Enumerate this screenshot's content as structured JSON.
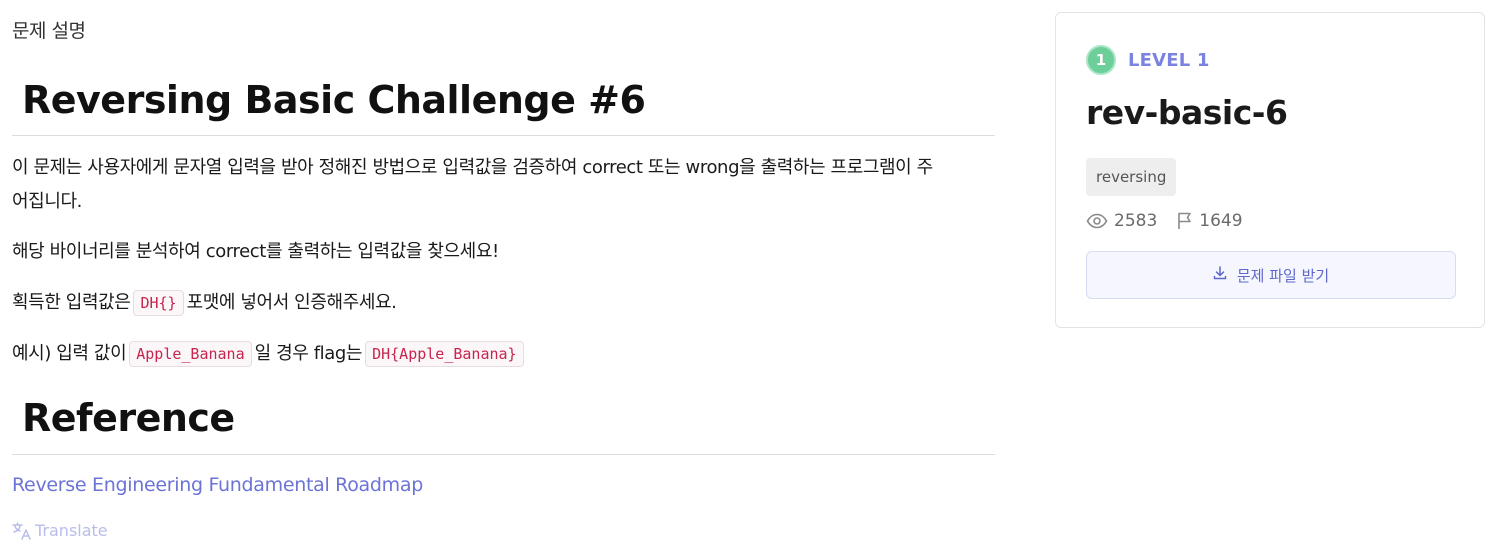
{
  "section_title": "문제 설명",
  "content": {
    "heading": "Reversing Basic Challenge #6",
    "paragraph1_line1": "이 문제는 사용자에게 문자열 입력을 받아 정해진 방법으로 입력값을 검증하여 correct 또는 wrong을 출력하는 프로그램이 주",
    "paragraph1_line2": "어집니다.",
    "paragraph2": "해당 바이너리를 분석하여 correct를 출력하는 입력값을 찾으세요!",
    "paragraph3_before": "획득한 입력값은",
    "paragraph3_code": "DH{}",
    "paragraph3_after": "포맷에 넣어서 인증해주세요.",
    "paragraph4_before": "예시) 입력 값이",
    "paragraph4_code1": "Apple_Banana",
    "paragraph4_middle": "일 경우 flag는",
    "paragraph4_code2": "DH{Apple_Banana}",
    "reference_heading": "Reference",
    "reference_link": "Reverse Engineering Fundamental Roadmap",
    "translate_label": "Translate"
  },
  "card": {
    "level_number": "1",
    "level_label": "LEVEL 1",
    "title": "rev-basic-6",
    "tag": "reversing",
    "views": "2583",
    "solves": "1649",
    "download_label": "문제 파일 받기"
  },
  "colors": {
    "accent": "#7b83e0",
    "level_green": "#6ccf9a",
    "code_red": "#c7254e",
    "link": "#6b73d6"
  },
  "icons": {
    "views": "eye-icon",
    "solves": "flag-icon",
    "download": "download-icon",
    "translate": "translate-icon"
  }
}
